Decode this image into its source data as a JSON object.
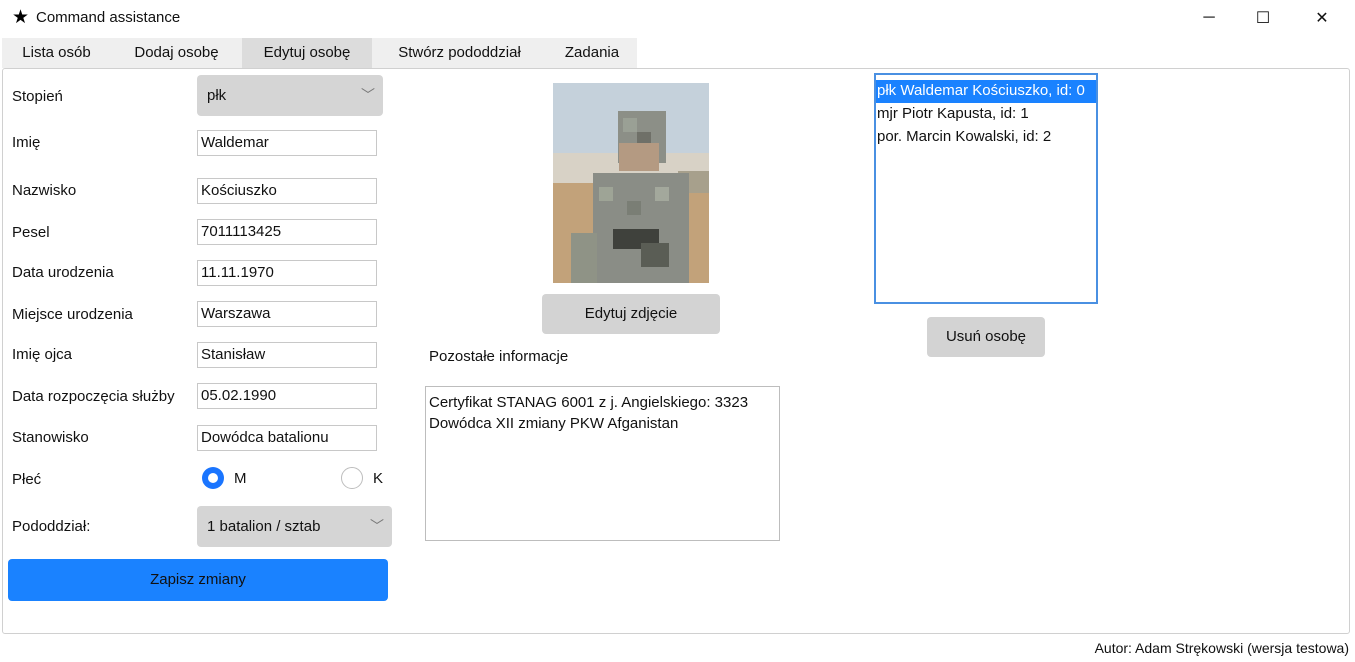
{
  "window": {
    "title": "Command assistance",
    "icon": "star-icon",
    "min_glyph": "─",
    "max_glyph": "☐",
    "close_glyph": "✕"
  },
  "tabs": [
    {
      "label": "Lista osób"
    },
    {
      "label": "Dodaj osobę"
    },
    {
      "label": "Edytuj osobę",
      "active": true
    },
    {
      "label": "Stwórz pododdział"
    },
    {
      "label": "Zadania"
    }
  ],
  "form": {
    "rank": {
      "label": "Stopień",
      "value": "płk"
    },
    "first_name": {
      "label": "Imię",
      "value": "Waldemar"
    },
    "last_name": {
      "label": "Nazwisko",
      "value": "Kościuszko"
    },
    "pesel": {
      "label": "Pesel",
      "value": "7011113425"
    },
    "birth_date": {
      "label": "Data urodzenia",
      "value": "11.11.1970"
    },
    "birth_place": {
      "label": "Miejsce urodzenia",
      "value": "Warszawa"
    },
    "father_name": {
      "label": "Imię ojca",
      "value": "Stanisław"
    },
    "service_start": {
      "label": "Data rozpoczęcia służby",
      "value": "05.02.1990"
    },
    "position": {
      "label": "Stanowisko",
      "value": "Dowódca batalionu"
    },
    "sex": {
      "label": "Płeć",
      "male": "M",
      "female": "K",
      "selected": "M"
    },
    "subunit": {
      "label": "Pododdział:",
      "value": "1 batalion / sztab"
    },
    "save_label": "Zapisz zmiany"
  },
  "photo": {
    "edit_label": "Edytuj zdjęcie"
  },
  "notes": {
    "label": "Pozostałe informacje",
    "line1": "Certyfikat STANAG 6001 z j. Angielskiego: 3323",
    "line2": "Dowódca XII zmiany PKW Afganistan"
  },
  "people_list": {
    "items": [
      {
        "label": "płk Waldemar Kościuszko, id: 0",
        "selected": true
      },
      {
        "label": "mjr Piotr Kapusta, id: 1"
      },
      {
        "label": "por. Marcin Kowalski, id: 2"
      }
    ],
    "delete_label": "Usuń osobę"
  },
  "footer": {
    "author": "Autor: Adam Strękowski (wersja testowa)"
  },
  "colors": {
    "accent": "#1a82ff",
    "selection": "#1a82ff"
  }
}
